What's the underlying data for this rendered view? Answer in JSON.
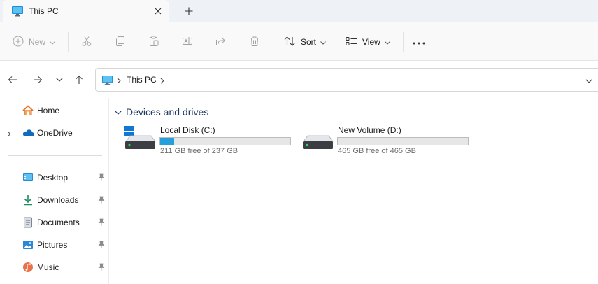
{
  "window": {
    "tab_title": "This PC"
  },
  "toolbar": {
    "new_label": "New",
    "sort_label": "Sort",
    "view_label": "View"
  },
  "address": {
    "crumb": "This PC"
  },
  "sidebar": {
    "items": [
      {
        "label": "Home",
        "icon": "home-icon"
      },
      {
        "label": "OneDrive",
        "icon": "onedrive-icon"
      },
      {
        "label": "Desktop",
        "icon": "desktop-icon"
      },
      {
        "label": "Downloads",
        "icon": "downloads-icon"
      },
      {
        "label": "Documents",
        "icon": "documents-icon"
      },
      {
        "label": "Pictures",
        "icon": "pictures-icon"
      },
      {
        "label": "Music",
        "icon": "music-icon"
      }
    ]
  },
  "content": {
    "group_title": "Devices and drives",
    "drives": [
      {
        "name": "Local Disk (C:)",
        "free_text": "211 GB free of 237 GB",
        "used_fraction": 0.11,
        "system": true
      },
      {
        "name": "New Volume (D:)",
        "free_text": "465 GB free of 465 GB",
        "used_fraction": 0.0,
        "system": false
      }
    ]
  },
  "colors": {
    "accent": "#26a0da",
    "group_title": "#1f3a63"
  }
}
